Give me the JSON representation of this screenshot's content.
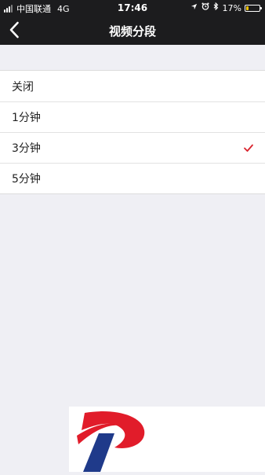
{
  "status_bar": {
    "carrier": "中国联通",
    "network": "4G",
    "time": "17:46",
    "battery_percent": "17%",
    "battery_level": 0.17,
    "battery_color": "#f5c400",
    "icons": [
      "signal-icon",
      "location-icon",
      "alarm-icon",
      "bluetooth-icon",
      "battery-icon"
    ]
  },
  "navbar": {
    "title": "视频分段",
    "back_icon": "chevron-left-icon",
    "background": "#1c1c1e"
  },
  "options": [
    {
      "label": "关闭",
      "selected": false
    },
    {
      "label": "1分钟",
      "selected": false
    },
    {
      "label": "3分钟",
      "selected": true
    },
    {
      "label": "5分钟",
      "selected": false
    }
  ],
  "accent_color": "#d9232d",
  "page_background": "#efeff4"
}
